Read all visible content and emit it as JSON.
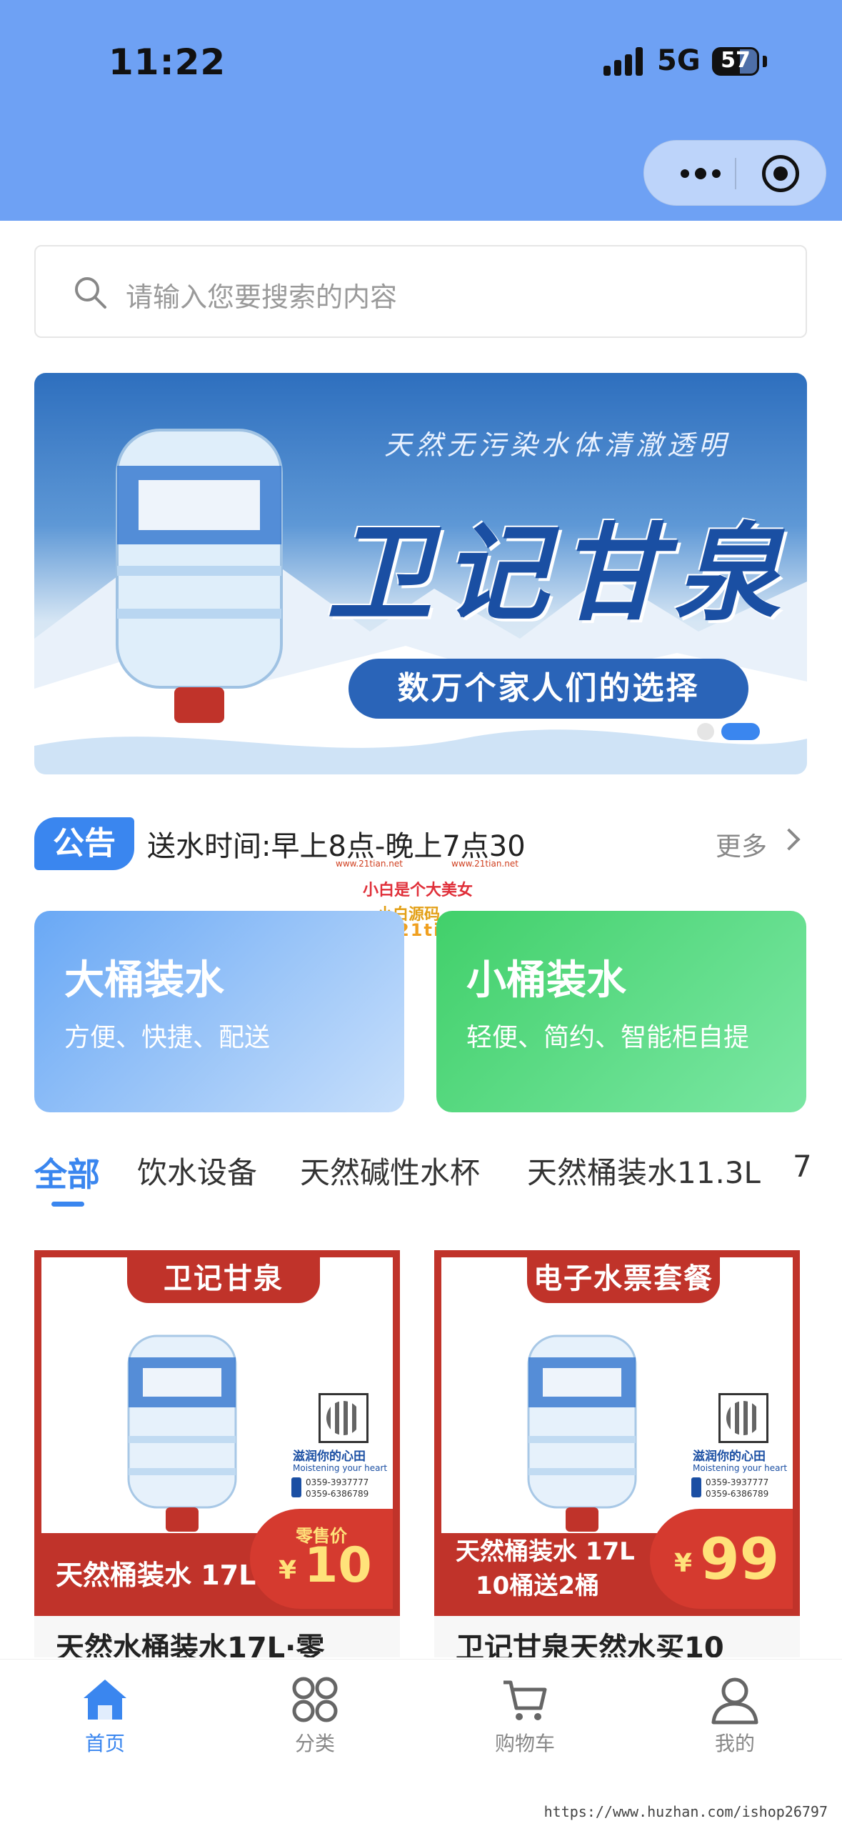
{
  "status_bar": {
    "time": "11:22",
    "network": "5G",
    "battery": "57"
  },
  "search": {
    "placeholder": "请输入您要搜索的内容"
  },
  "banner": {
    "slogan": "天然无污染水体清澈透明",
    "brand": "卫记甘泉",
    "tagline": "数万个家人们的选择",
    "slides": 2,
    "active_slide": 2
  },
  "notice": {
    "badge": "公告",
    "text": "送水时间:早上8点-晚上7点30",
    "more": "更多"
  },
  "watermark": {
    "line1": "www.21tian.net",
    "line2": "小白是个大美女",
    "line3": "小白源码",
    "line4": "www.21tian.net"
  },
  "cards": [
    {
      "title": "大桶装水",
      "subtitle": "方便、快捷、配送",
      "color": "#69a8f5"
    },
    {
      "title": "小桶装水",
      "subtitle": "轻便、简约、智能柜自提",
      "color": "#41d06a"
    }
  ],
  "tabs": [
    {
      "label": "全部",
      "active": true
    },
    {
      "label": "饮水设备"
    },
    {
      "label": "天然碱性水杯"
    },
    {
      "label": "天然桶装水11.3L"
    },
    {
      "label": "7"
    }
  ],
  "products": [
    {
      "ribbon": "卫记甘泉",
      "label": "天然桶装水 17L",
      "label2": "",
      "retail_tag": "零售价",
      "currency": "¥",
      "price": "10",
      "name": "天然水桶装水17L·零",
      "qr_text": "滋润你的心田",
      "qr_sub": "Moistening your heart",
      "phone1": "0359-3937777",
      "phone2": "0359-6386789"
    },
    {
      "ribbon": "电子水票套餐",
      "label": "天然桶装水 17L",
      "label2": "10桶送2桶",
      "retail_tag": "",
      "currency": "¥",
      "price": "99",
      "name": "卫记甘泉天然水买10",
      "qr_text": "滋润你的心田",
      "qr_sub": "Moistening your heart",
      "phone1": "0359-3937777",
      "phone2": "0359-6386789"
    }
  ],
  "tabbar": [
    {
      "label": "首页",
      "icon": "home-icon",
      "active": true
    },
    {
      "label": "分类",
      "icon": "category-icon"
    },
    {
      "label": "购物车",
      "icon": "cart-icon"
    },
    {
      "label": "我的",
      "icon": "user-icon"
    }
  ],
  "footer": "https://www.huzhan.com/ishop26797",
  "colors": {
    "accent": "#3a86ef",
    "header": "#6ea1f4",
    "product_red": "#c0332a"
  }
}
